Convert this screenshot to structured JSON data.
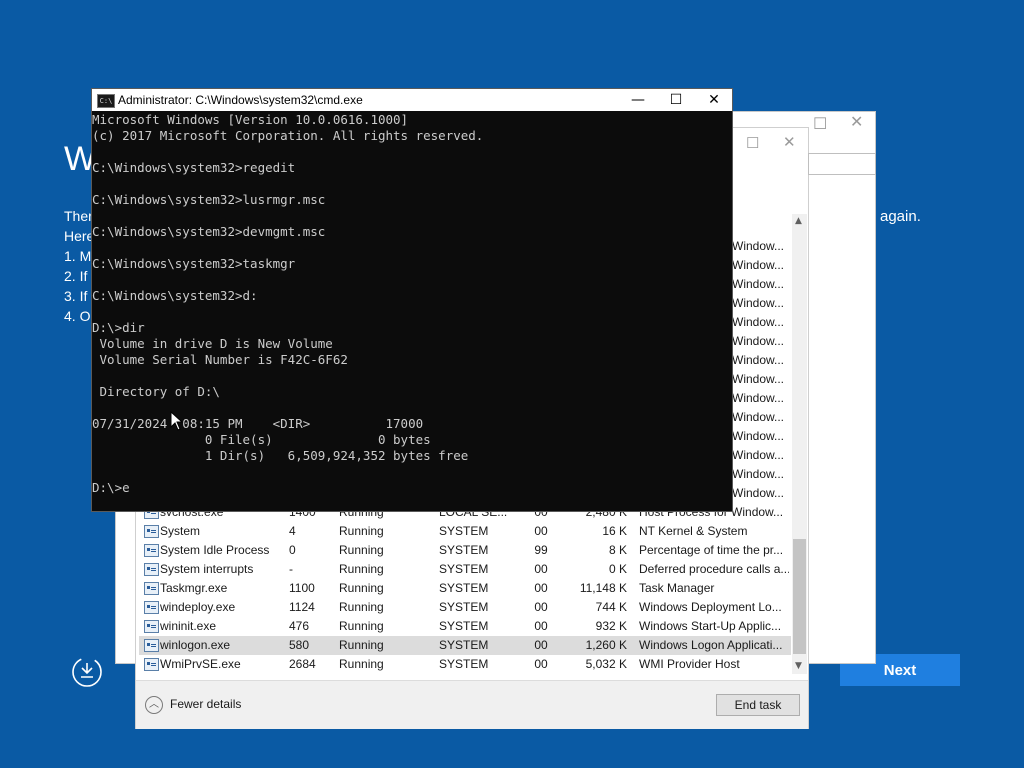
{
  "setup": {
    "big_letter": "W",
    "lines": [
      "Ther",
      "Here",
      "1. M",
      "2. If",
      "3. If",
      "4. O"
    ],
    "again_text": "again.",
    "next_label": "Next"
  },
  "taskmgr": {
    "top_row": {
      "name": "svchost.exe",
      "pid": "1400",
      "status": "Running",
      "user": "LOCAL SE...",
      "cpu": "00",
      "mem": "2,480 K",
      "desc": "Host Process for Window..."
    },
    "window_desc_partial": "Window...",
    "rows": [
      {
        "name": "System",
        "pid": "4",
        "status": "Running",
        "user": "SYSTEM",
        "cpu": "00",
        "mem": "16 K",
        "desc": "NT Kernel & System"
      },
      {
        "name": "System Idle Process",
        "pid": "0",
        "status": "Running",
        "user": "SYSTEM",
        "cpu": "99",
        "mem": "8 K",
        "desc": "Percentage of time the pr..."
      },
      {
        "name": "System interrupts",
        "pid": "-",
        "status": "Running",
        "user": "SYSTEM",
        "cpu": "00",
        "mem": "0 K",
        "desc": "Deferred procedure calls a..."
      },
      {
        "name": "Taskmgr.exe",
        "pid": "1100",
        "status": "Running",
        "user": "SYSTEM",
        "cpu": "00",
        "mem": "11,148 K",
        "desc": "Task Manager"
      },
      {
        "name": "windeploy.exe",
        "pid": "1124",
        "status": "Running",
        "user": "SYSTEM",
        "cpu": "00",
        "mem": "744 K",
        "desc": "Windows Deployment Lo..."
      },
      {
        "name": "wininit.exe",
        "pid": "476",
        "status": "Running",
        "user": "SYSTEM",
        "cpu": "00",
        "mem": "932 K",
        "desc": "Windows Start-Up Applic..."
      },
      {
        "name": "winlogon.exe",
        "pid": "580",
        "status": "Running",
        "user": "SYSTEM",
        "cpu": "00",
        "mem": "1,260 K",
        "desc": "Windows Logon Applicati..."
      },
      {
        "name": "WmiPrvSE.exe",
        "pid": "2684",
        "status": "Running",
        "user": "SYSTEM",
        "cpu": "00",
        "mem": "5,032 K",
        "desc": "WMI Provider Host"
      }
    ],
    "fewer_details": "Fewer details",
    "end_task": "End task"
  },
  "cmd": {
    "title": "Administrator: C:\\Windows\\system32\\cmd.exe",
    "icon_text": "C:\\",
    "lines": [
      "Microsoft Windows [Version 10.0.0616.1000]",
      "(c) 2017 Microsoft Corporation. All rights reserved.",
      "",
      "C:\\Windows\\system32>regedit",
      "",
      "C:\\Windows\\system32>lusrmgr.msc",
      "",
      "C:\\Windows\\system32>devmgmt.msc",
      "",
      "C:\\Windows\\system32>taskmgr",
      "",
      "C:\\Windows\\system32>d:",
      "",
      "D:\\>dir",
      " Volume in drive D is New Volume",
      " Volume Serial Number is F42C-6F62",
      "",
      " Directory of D:\\",
      "",
      "07/31/2024  08:15 PM    <DIR>          17000",
      "               0 File(s)              0 bytes",
      "               1 Dir(s)   6,509,924,352 bytes free",
      "",
      "D:\\>e"
    ]
  }
}
